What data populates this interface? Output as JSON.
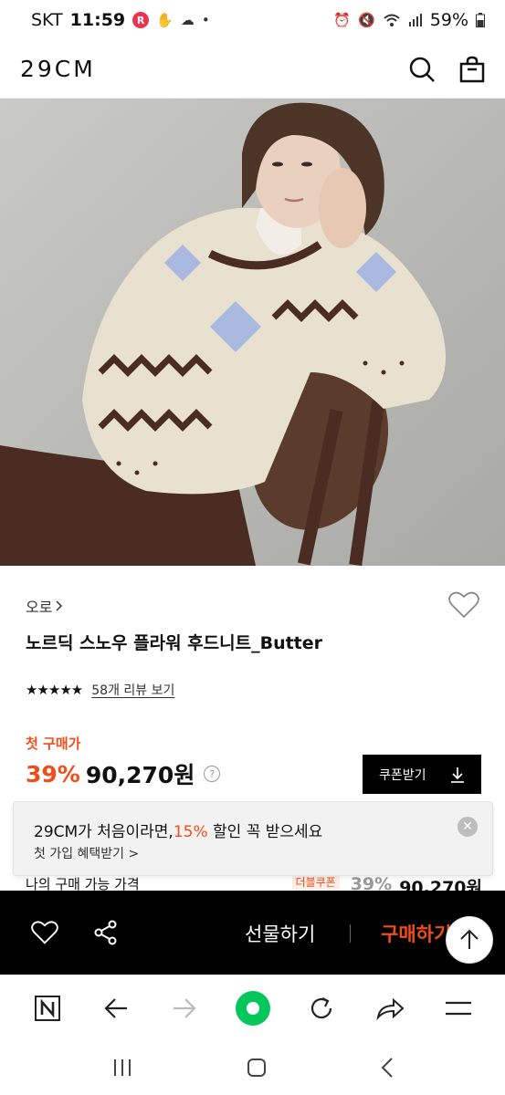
{
  "status_bar": {
    "carrier": "SKT",
    "time": "11:59",
    "notification_badge": "R",
    "battery": "59%"
  },
  "header": {
    "brand": "29CM"
  },
  "product": {
    "brand_name": "오로",
    "title": "노르딕 스노우 플라워 후드니트_Butter",
    "stars": "★★★★★",
    "review_link": "58개 리뷰 보기",
    "first_purchase_label": "첫 구매가",
    "discount": "39%",
    "price": "90,270원",
    "price_help": "?"
  },
  "coupon_button": {
    "label": "쿠폰받기"
  },
  "promo_toast": {
    "prefix": "29CM가 처음이라면,",
    "highlight": "15%",
    "suffix": " 할인 꼭 받으세요",
    "link": "첫 가입 혜택받기 >"
  },
  "my_price_row": {
    "label": "나의 구매 가능 가격",
    "tag": "더블쿠폰",
    "discount": "39%",
    "price": "90,270원"
  },
  "action_bar": {
    "gift_label": "선물하기",
    "buy_label": "구매하기"
  },
  "colors": {
    "accent": "#f04d1a",
    "naver_green": "#03c75a"
  },
  "icons": [
    "search-icon",
    "cart-icon",
    "heart-icon",
    "share-icon",
    "arrow-up-icon",
    "naver-n-icon",
    "back-icon",
    "forward-icon",
    "home-dot-icon",
    "refresh-icon",
    "share-arrow-icon",
    "menu-icon"
  ]
}
